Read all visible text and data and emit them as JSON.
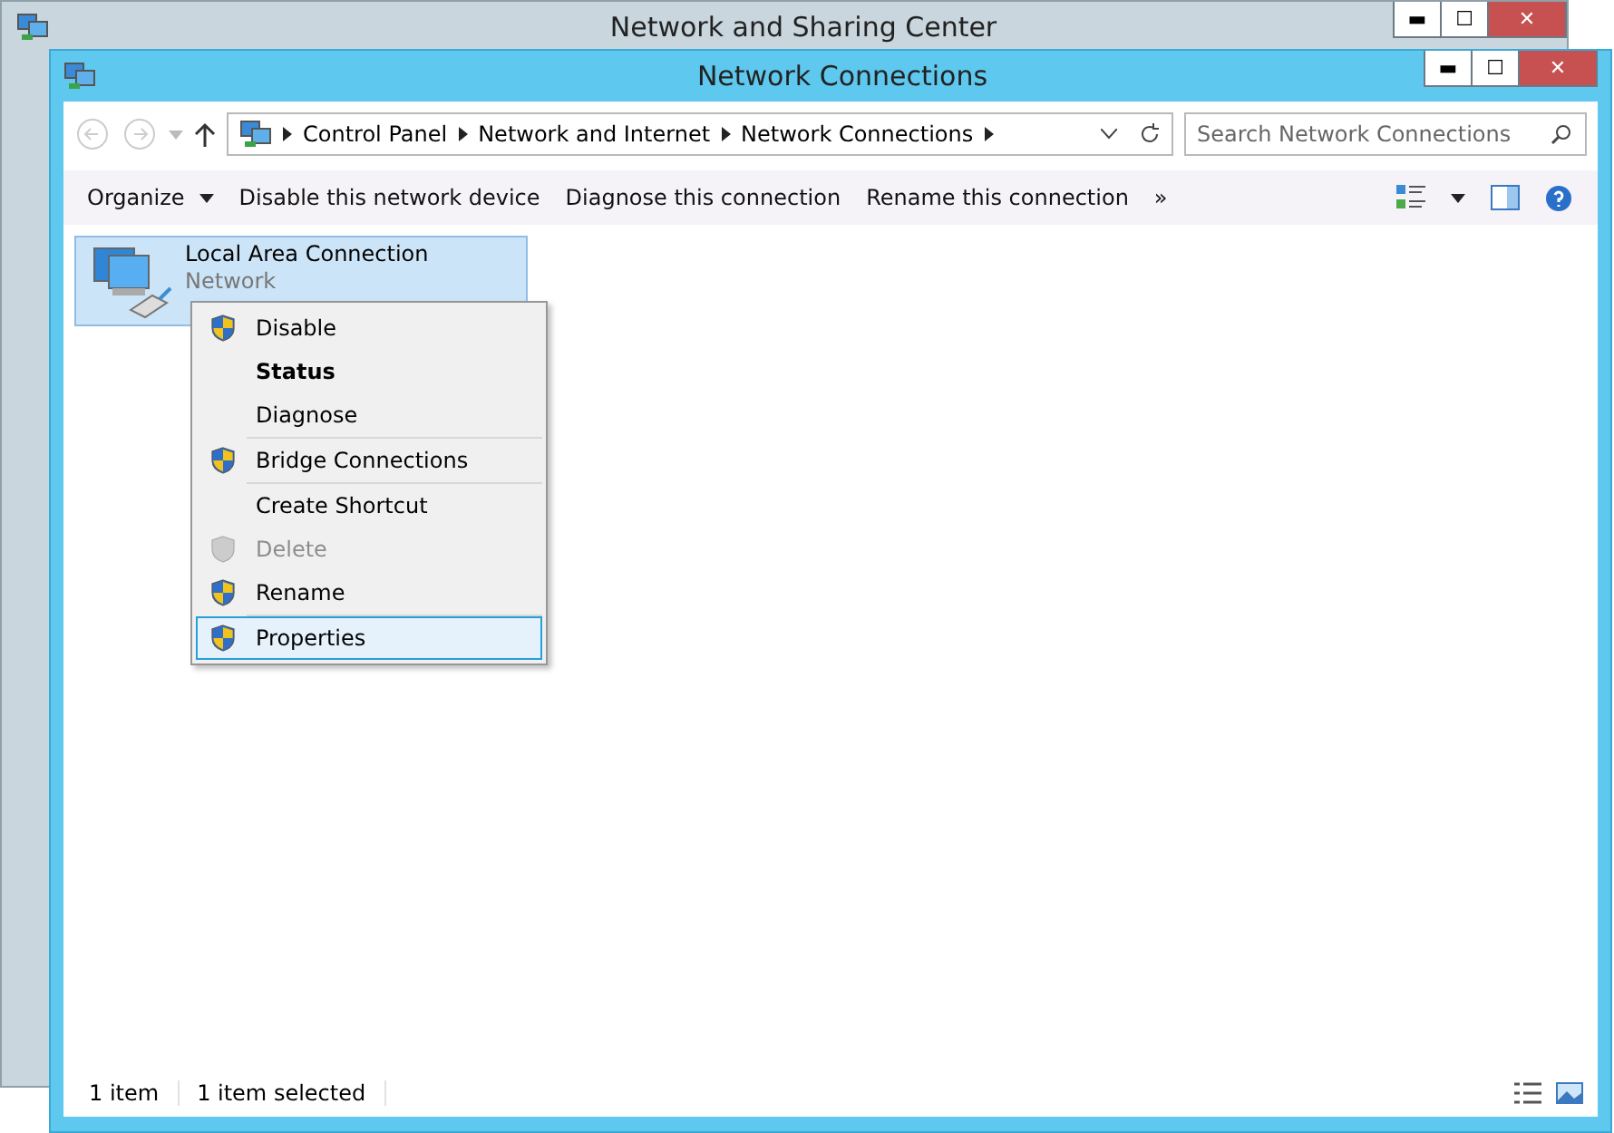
{
  "back_window": {
    "title": "Network and Sharing Center",
    "controls": {
      "minimize": "▬",
      "maximize": "☐",
      "close": "✕"
    }
  },
  "window": {
    "title": "Network Connections",
    "controls": {
      "minimize": "▬",
      "maximize": "☐",
      "close": "✕"
    }
  },
  "breadcrumb": [
    "Control Panel",
    "Network and Internet",
    "Network Connections"
  ],
  "search": {
    "placeholder": "Search Network Connections"
  },
  "commands": [
    {
      "label": "Organize",
      "dropdown": true
    },
    {
      "label": "Disable this network device",
      "dropdown": false
    },
    {
      "label": "Diagnose this connection",
      "dropdown": false
    },
    {
      "label": "Rename this connection",
      "dropdown": false
    }
  ],
  "more": "»",
  "connections": [
    {
      "name": "Local Area Connection",
      "status": "Network",
      "selected": true
    }
  ],
  "context_menu": [
    [
      {
        "label": "Disable",
        "shield": true,
        "default": false,
        "disabled": false,
        "selected": false
      },
      {
        "label": "Status",
        "shield": false,
        "default": true,
        "disabled": false,
        "selected": false
      },
      {
        "label": "Diagnose",
        "shield": false,
        "default": false,
        "disabled": false,
        "selected": false
      }
    ],
    [
      {
        "label": "Bridge Connections",
        "shield": true,
        "default": false,
        "disabled": false,
        "selected": false
      }
    ],
    [
      {
        "label": "Create Shortcut",
        "shield": false,
        "default": false,
        "disabled": false,
        "selected": false
      },
      {
        "label": "Delete",
        "shield": true,
        "default": false,
        "disabled": true,
        "selected": false
      },
      {
        "label": "Rename",
        "shield": true,
        "default": false,
        "disabled": false,
        "selected": false
      }
    ],
    [
      {
        "label": "Properties",
        "shield": true,
        "default": false,
        "disabled": false,
        "selected": true
      }
    ]
  ],
  "status_bar": {
    "count": "1 item",
    "selection": "1 item selected"
  }
}
